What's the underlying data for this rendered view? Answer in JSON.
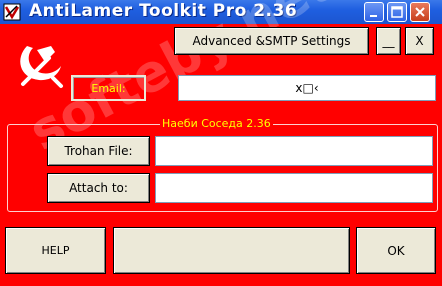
{
  "window": {
    "title": "AntiLamer Toolkit  Pro 2.36",
    "min_glyph": "_",
    "max_glyph": "□",
    "close_glyph": "×"
  },
  "toolbar": {
    "advanced_label": "Advanced &SMTP  Settings",
    "minimize_label": "__",
    "close_label": "X"
  },
  "email": {
    "label": "Email:",
    "value": "x□‹"
  },
  "group": {
    "legend": "Наеби Соседа 2.36",
    "trohan_label": "Trohan File:",
    "trohan_value": "",
    "attach_label": "Attach to:",
    "attach_value": ""
  },
  "bottom": {
    "help_label": "HELP",
    "status_text": "",
    "ok_label": "OK"
  },
  "watermark": "softeby.net",
  "colors": {
    "background": "#ff0000",
    "label_yellow": "#ffff00",
    "button_face": "#ece9d8",
    "titlebar": "#1f5fe0"
  },
  "icons": [
    "hammer-sickle-icon",
    "app-icon"
  ]
}
